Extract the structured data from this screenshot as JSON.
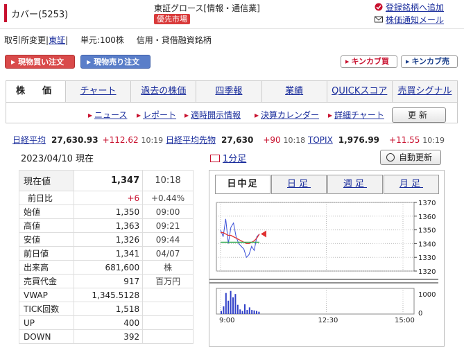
{
  "header": {
    "company": "カバー(5253)",
    "market": "東証グロース[情報・通信業]",
    "priority_badge": "優先市場",
    "links": [
      "登録銘柄へ追加",
      "株価通知メール"
    ]
  },
  "info": {
    "exchange_label": "取引所変更",
    "exchange_value": "東証",
    "unit": "単元:100株",
    "margin": "信用・貸借融資銘柄"
  },
  "buttons": {
    "buy": "現物買い注文",
    "sell": "現物売り注文",
    "kinkabu_buy": "キンカブ買",
    "kinkabu_sell": "キンカブ売"
  },
  "tabs": [
    "株　価",
    "チャート",
    "過去の株価",
    "四季報",
    "業績",
    "QUICKスコア",
    "売買シグナル"
  ],
  "subtabs": [
    "ニュース",
    "レポート",
    "適時開示情報",
    "決算カレンダー",
    "詳細チャート"
  ],
  "refresh_label": "更新",
  "indices": [
    {
      "name": "日経平均",
      "value": "27,630.93",
      "change": "+112.62",
      "time": "10:19"
    },
    {
      "name": "日経平均先物",
      "value": "27,630",
      "change": "+90",
      "time": "10:18"
    },
    {
      "name": "TOPIX",
      "value": "1,976.99",
      "change": "+11.55",
      "time": "10:19"
    }
  ],
  "date_line": "2023/04/10 現在",
  "minute_link": "1分足",
  "auto_refresh": "自動更新",
  "quote": {
    "current_label": "現在値",
    "current_value": "1,347",
    "current_time": "10:18",
    "prev_label": "前日比",
    "prev_change": "+6",
    "prev_pct": "+0.44%",
    "rows": [
      {
        "label": "始値",
        "value": "1,350",
        "extra": "09:00"
      },
      {
        "label": "高値",
        "value": "1,363",
        "extra": "09:21"
      },
      {
        "label": "安値",
        "value": "1,326",
        "extra": "09:44"
      },
      {
        "label": "前日値",
        "value": "1,341",
        "extra": "04/07"
      },
      {
        "label": "出来高",
        "value": "681,600",
        "extra": "株"
      },
      {
        "label": "売買代金",
        "value": "917",
        "extra": "百万円"
      },
      {
        "label": "VWAP",
        "value": "1,345.5128",
        "extra": ""
      },
      {
        "label": "TICK回数",
        "value": "1,518",
        "extra": ""
      },
      {
        "label": "UP",
        "value": "400",
        "extra": ""
      },
      {
        "label": "DOWN",
        "value": "392",
        "extra": ""
      }
    ]
  },
  "chart_tabs": [
    "日中足",
    "日足",
    "週足",
    "月足"
  ],
  "chart_data": {
    "type": "line",
    "price_ticks": [
      "1370",
      "1360",
      "1350",
      "1340",
      "1330",
      "1320"
    ],
    "ylim": [
      1320,
      1370
    ],
    "volume_tick": "1000",
    "volume_tick_zero": "0",
    "x_ticks": [
      "9:00",
      "12:30",
      "15:00"
    ],
    "prev_close": 1341,
    "series": [
      {
        "values": [
          1350,
          1345,
          1358,
          1340,
          1352,
          1355,
          1345,
          1340,
          1338,
          1336,
          1330,
          1332,
          1338,
          1335,
          1345,
          1347
        ]
      },
      {
        "values": [
          1348,
          1348,
          1347,
          1346,
          1346,
          1345,
          1344,
          1343,
          1342,
          1341,
          1340,
          1340,
          1341,
          1342,
          1344,
          1347
        ]
      }
    ],
    "volume": [
      120,
      300,
      820,
      520,
      900,
      650,
      780,
      360,
      180,
      120,
      380,
      160,
      260,
      160,
      140,
      120,
      90
    ]
  }
}
